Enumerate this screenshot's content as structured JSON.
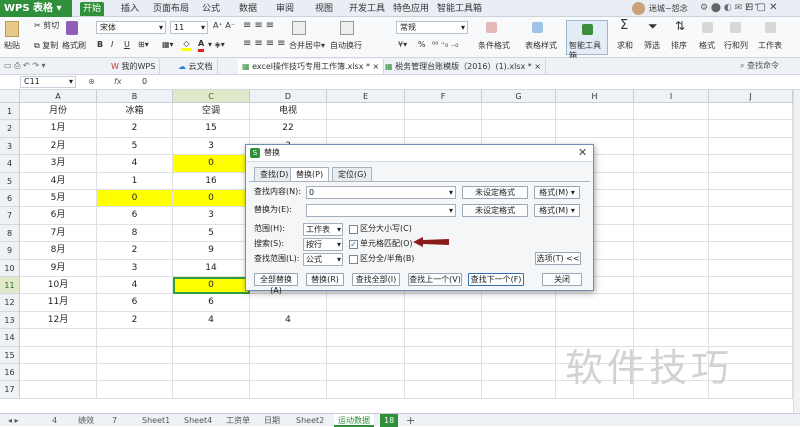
{
  "app": {
    "name": "WPS 表格"
  },
  "menu": {
    "tabs": [
      "开始",
      "插入",
      "页面布局",
      "公式",
      "数据",
      "审阅",
      "视图",
      "开发工具",
      "特色应用",
      "智能工具箱"
    ]
  },
  "user": {
    "name": "迷城~怨念"
  },
  "ribbon": {
    "paste": "粘贴",
    "cut": "剪切",
    "copy": "复制",
    "format_painter": "格式刷",
    "font": "宋体",
    "font_size": "11",
    "merge": "合并居中",
    "wrap": "自动换行",
    "number_format": "常规",
    "cond_format": "条件格式",
    "table_style": "表格样式",
    "smart_toolbox": "智能工具箱",
    "sum": "求和",
    "filter": "筛选",
    "sort": "排序",
    "format": "格式",
    "row_col": "行和列",
    "worksheet": "工作表",
    "bold": "B",
    "italic": "I",
    "underline": "U",
    "percent": "%"
  },
  "doc_tabs": {
    "my_wps": "我的WPS",
    "cloud": "云文档",
    "file1": "excel操作技巧专用工作簿.xlsx *",
    "file2": "税务管理台账模版（2016）(1).xlsx *",
    "search": "查找命令"
  },
  "formula_bar": {
    "cell_ref": "C11",
    "fx": "fx",
    "value": "0"
  },
  "columns": [
    "A",
    "B",
    "C",
    "D",
    "E",
    "F",
    "G",
    "H",
    "I",
    "J"
  ],
  "rows": [
    {
      "n": "1",
      "a": "月份",
      "b": "冰箱",
      "c": "空调",
      "d": "电视"
    },
    {
      "n": "2",
      "a": "1月",
      "b": "2",
      "c": "15",
      "d": "22"
    },
    {
      "n": "3",
      "a": "2月",
      "b": "5",
      "c": "3",
      "d": "3"
    },
    {
      "n": "4",
      "a": "3月",
      "b": "4",
      "c": "0",
      "d": ""
    },
    {
      "n": "5",
      "a": "4月",
      "b": "1",
      "c": "16",
      "d": ""
    },
    {
      "n": "6",
      "a": "5月",
      "b": "0",
      "c": "0",
      "d": ""
    },
    {
      "n": "7",
      "a": "6月",
      "b": "6",
      "c": "3",
      "d": ""
    },
    {
      "n": "8",
      "a": "7月",
      "b": "8",
      "c": "5",
      "d": ""
    },
    {
      "n": "9",
      "a": "8月",
      "b": "2",
      "c": "9",
      "d": ""
    },
    {
      "n": "10",
      "a": "9月",
      "b": "3",
      "c": "14",
      "d": ""
    },
    {
      "n": "11",
      "a": "10月",
      "b": "4",
      "c": "0",
      "d": ""
    },
    {
      "n": "12",
      "a": "11月",
      "b": "6",
      "c": "6",
      "d": ""
    },
    {
      "n": "13",
      "a": "12月",
      "b": "2",
      "c": "4",
      "d": "4"
    },
    {
      "n": "14",
      "a": "",
      "b": "",
      "c": "",
      "d": ""
    },
    {
      "n": "15",
      "a": "",
      "b": "",
      "c": "",
      "d": ""
    },
    {
      "n": "16",
      "a": "",
      "b": "",
      "c": "",
      "d": ""
    },
    {
      "n": "17",
      "a": "",
      "b": "",
      "c": "",
      "d": ""
    }
  ],
  "sheet_tabs": [
    "4",
    "绩效",
    "7",
    "Sheet1",
    "Sheet4",
    "工资单",
    "日期",
    "Sheet2",
    "运动数据",
    "18"
  ],
  "dialog": {
    "title": "替换",
    "tabs": [
      "查找(D)",
      "替换(P)",
      "定位(G)"
    ],
    "find_label": "查找内容(N):",
    "find_value": "0",
    "replace_label": "替换为(E):",
    "replace_value": "",
    "format_status_find": "未设定格式",
    "format_status_replace": "未设定格式",
    "format_btn": "格式(M)",
    "scope_label": "范围(H):",
    "scope_value": "工作表",
    "search_label": "搜索(S):",
    "search_value": "按行",
    "lookin_label": "查找范围(L):",
    "lookin_value": "公式",
    "case_label": "区分大小写(C)",
    "whole_cell_label": "单元格匹配(O)",
    "width_label": "区分全/半角(B)",
    "options_btn": "选项(T) <<",
    "replace_all": "全部替换(A)",
    "replace": "替换(R)",
    "find_all": "查找全部(I)",
    "find_prev": "查找上一个(V)",
    "find_next": "查找下一个(F)",
    "close": "关闭"
  },
  "watermark": "软件技巧",
  "colors": {
    "accent": "#2f8f3a",
    "highlight": "#ffff00",
    "arrow": "#8b1a1a"
  }
}
